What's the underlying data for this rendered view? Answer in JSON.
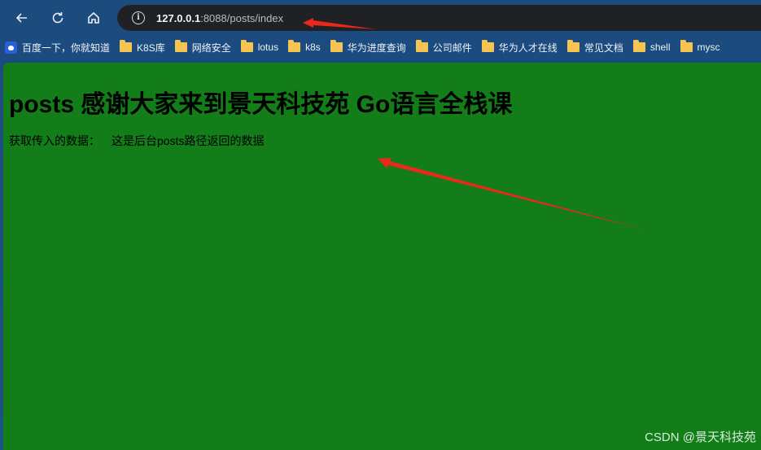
{
  "browser": {
    "address_bar": {
      "host": "127.0.0.1",
      "rest": ":8088/posts/index"
    }
  },
  "bookmarks": [
    {
      "label": "百度一下，你就知道",
      "icon": "baidu-icon"
    },
    {
      "label": "K8S库",
      "icon": "folder-icon"
    },
    {
      "label": "网络安全",
      "icon": "folder-icon"
    },
    {
      "label": "lotus",
      "icon": "folder-icon"
    },
    {
      "label": "k8s",
      "icon": "folder-icon"
    },
    {
      "label": "华为进度查询",
      "icon": "folder-icon"
    },
    {
      "label": "公司邮件",
      "icon": "folder-icon"
    },
    {
      "label": "华为人才在线",
      "icon": "folder-icon"
    },
    {
      "label": "常见文档",
      "icon": "folder-icon"
    },
    {
      "label": "shell",
      "icon": "folder-icon"
    },
    {
      "label": "mysc",
      "icon": "folder-icon"
    }
  ],
  "page": {
    "title": "posts 感谢大家来到景天科技苑 Go语言全栈课",
    "data_label": "获取传入的数据：",
    "data_value": "这是后台posts路径返回的数据",
    "background": "#127d19"
  },
  "watermark": "CSDN @景天科技苑",
  "annotation_color": "#e8291c"
}
